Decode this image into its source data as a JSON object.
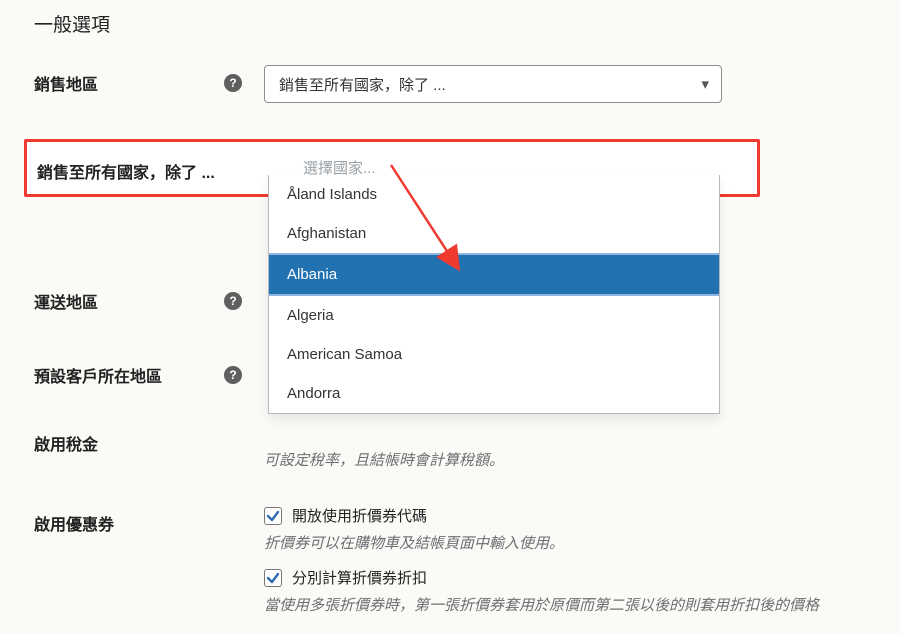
{
  "section_title": "一般選項",
  "fields": {
    "selling_region": {
      "label": "銷售地區",
      "help": "?",
      "select_value": "銷售至所有國家，除了 ..."
    },
    "exclude_countries": {
      "label": "銷售至所有國家，除了 ...",
      "placeholder": "選擇國家..."
    },
    "shipping_region": {
      "label": "運送地區",
      "help": "?"
    },
    "default_location": {
      "label": "預設客戶所在地區",
      "help": "?"
    },
    "tax": {
      "label": "啟用稅金",
      "note": "可設定稅率，且結帳時會計算稅額。"
    },
    "coupons": {
      "label": "啟用優惠券",
      "opt1_label": "開放使用折價券代碼",
      "opt1_note": "折價券可以在購物車及結帳頁面中輸入使用。",
      "opt2_label": "分別計算折價券折扣",
      "opt2_note": "當使用多張折價券時，第一張折價券套用於原價而第二張以後的則套用折扣後的價格"
    }
  },
  "dropdown_options": [
    {
      "label": "Åland Islands",
      "selected": false
    },
    {
      "label": "Afghanistan",
      "selected": false
    },
    {
      "label": "Albania",
      "selected": true
    },
    {
      "label": "Algeria",
      "selected": false
    },
    {
      "label": "American Samoa",
      "selected": false
    },
    {
      "label": "Andorra",
      "selected": false
    }
  ],
  "icons": {
    "help_glyph": "?",
    "check_glyph": "✓",
    "caret_glyph": "▾"
  }
}
